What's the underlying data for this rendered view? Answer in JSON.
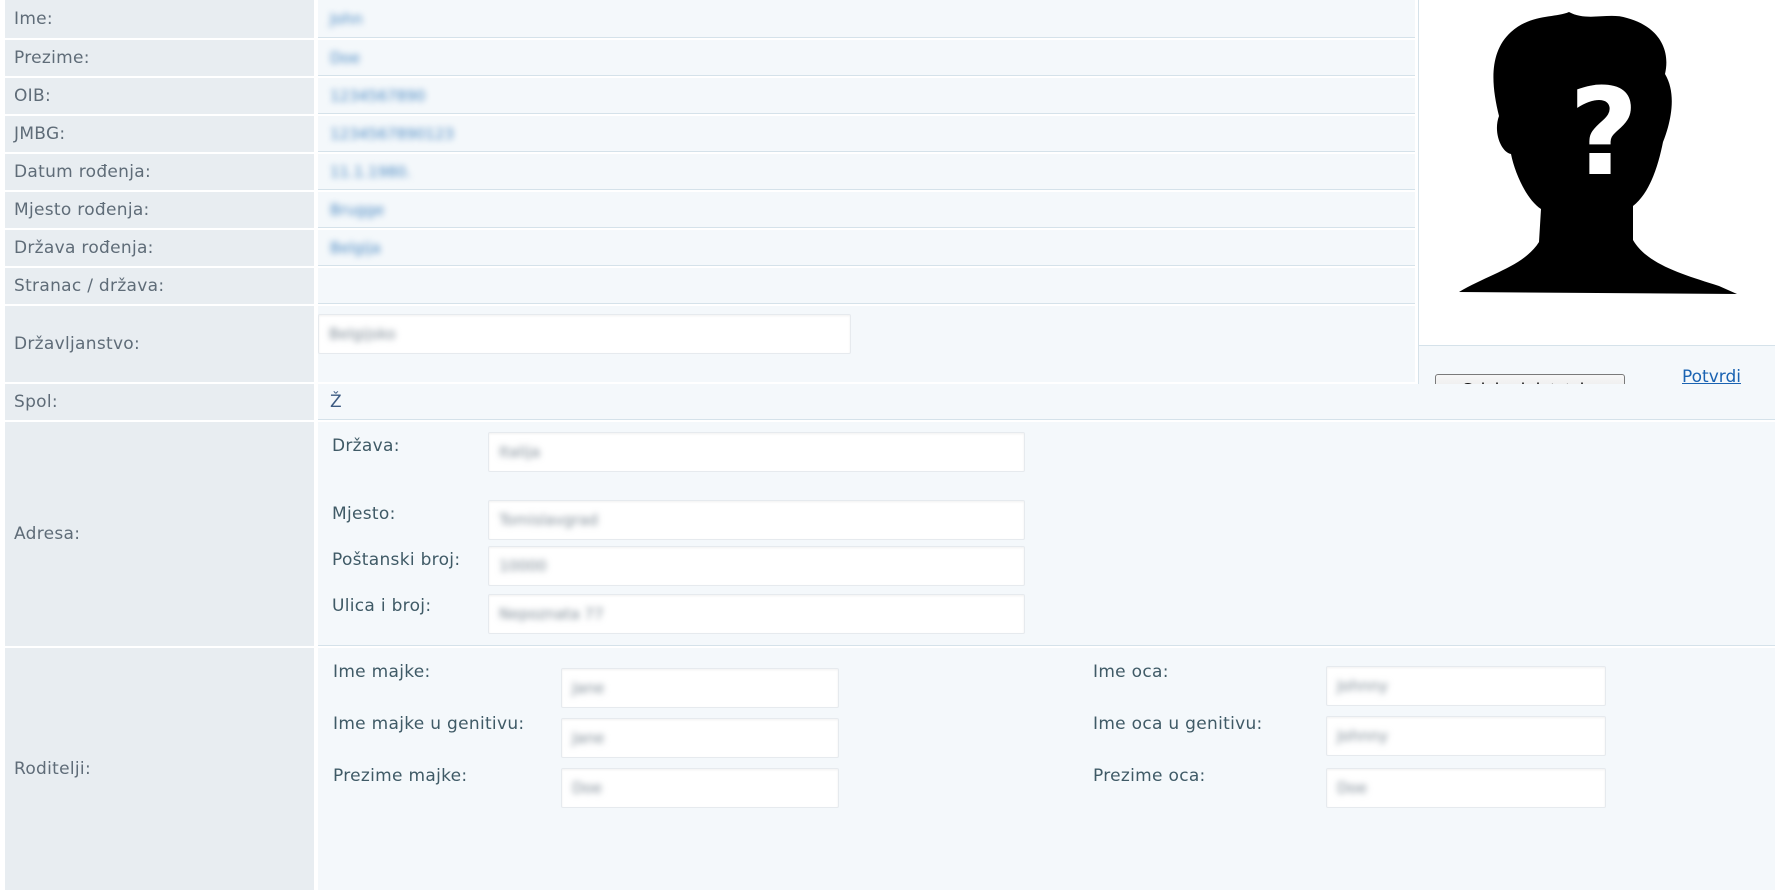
{
  "fields": {
    "ime": {
      "label": "Ime:",
      "value": "John"
    },
    "prezime": {
      "label": "Prezime:",
      "value": "Doe"
    },
    "oib": {
      "label": "OIB:",
      "value": "1234567890"
    },
    "jmbg": {
      "label": "JMBG:",
      "value": "1234567890123"
    },
    "datum_rodenja": {
      "label": "Datum rođenja:",
      "value": "11.1.1980."
    },
    "mjesto_rodenja": {
      "label": "Mjesto rođenja:",
      "value": "Brugge"
    },
    "drzava_rodenja": {
      "label": "Država rođenja:",
      "value": "Belgija"
    },
    "stranac": {
      "label": "Stranac / država:",
      "value": ""
    },
    "drzavljanstvo": {
      "label": "Državljanstvo:",
      "value": "Belgijsko"
    },
    "spol": {
      "label": "Spol:",
      "value": "Ž"
    }
  },
  "photo": {
    "icon": "unknown-person-silhouette-icon",
    "choose_file_label": "Odaberi datoteku",
    "confirm_label": "Potvrdi"
  },
  "adresa": {
    "label": "Adresa:",
    "drzava_label": "Država:",
    "drzava_value": "Italija",
    "mjesto_label": "Mjesto:",
    "mjesto_value": "Tomislavgrad",
    "postanski_label": "Poštanski broj:",
    "postanski_value": "10000",
    "ulica_label": "Ulica i broj:",
    "ulica_value": "Nepoznata 77"
  },
  "roditelji": {
    "label": "Roditelji:",
    "ime_majke_label": "Ime majke:",
    "ime_majke_value": "Jane",
    "ime_majke_gen_label": "Ime majke u genitivu:",
    "ime_majke_gen_value": "Jane",
    "prezime_majke_label": "Prezime majke:",
    "prezime_majke_value": "Doe",
    "ime_oca_label": "Ime oca:",
    "ime_oca_value": "Johnny",
    "ime_oca_gen_label": "Ime oca u genitivu:",
    "ime_oca_gen_value": "Johnny",
    "prezime_oca_label": "Prezime oca:",
    "prezime_oca_value": "Doe"
  }
}
